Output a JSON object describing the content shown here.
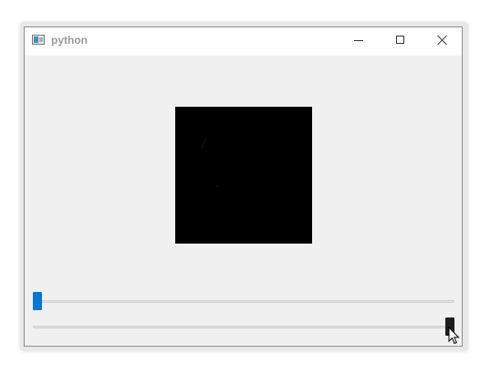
{
  "window": {
    "title": "python",
    "controls": {
      "minimize": "minimize-icon",
      "maximize": "maximize-icon",
      "close": "close-icon"
    }
  },
  "image": {
    "background": "#000000"
  },
  "sliders": [
    {
      "name": "top-slider",
      "value_fraction": 0.0,
      "handle_color": "#0078d7",
      "state": "focused"
    },
    {
      "name": "bottom-slider",
      "value_fraction": 1.0,
      "handle_color": "#1e1e1e",
      "state": "pressed"
    }
  ],
  "cursor": "arrow-pointer-icon"
}
